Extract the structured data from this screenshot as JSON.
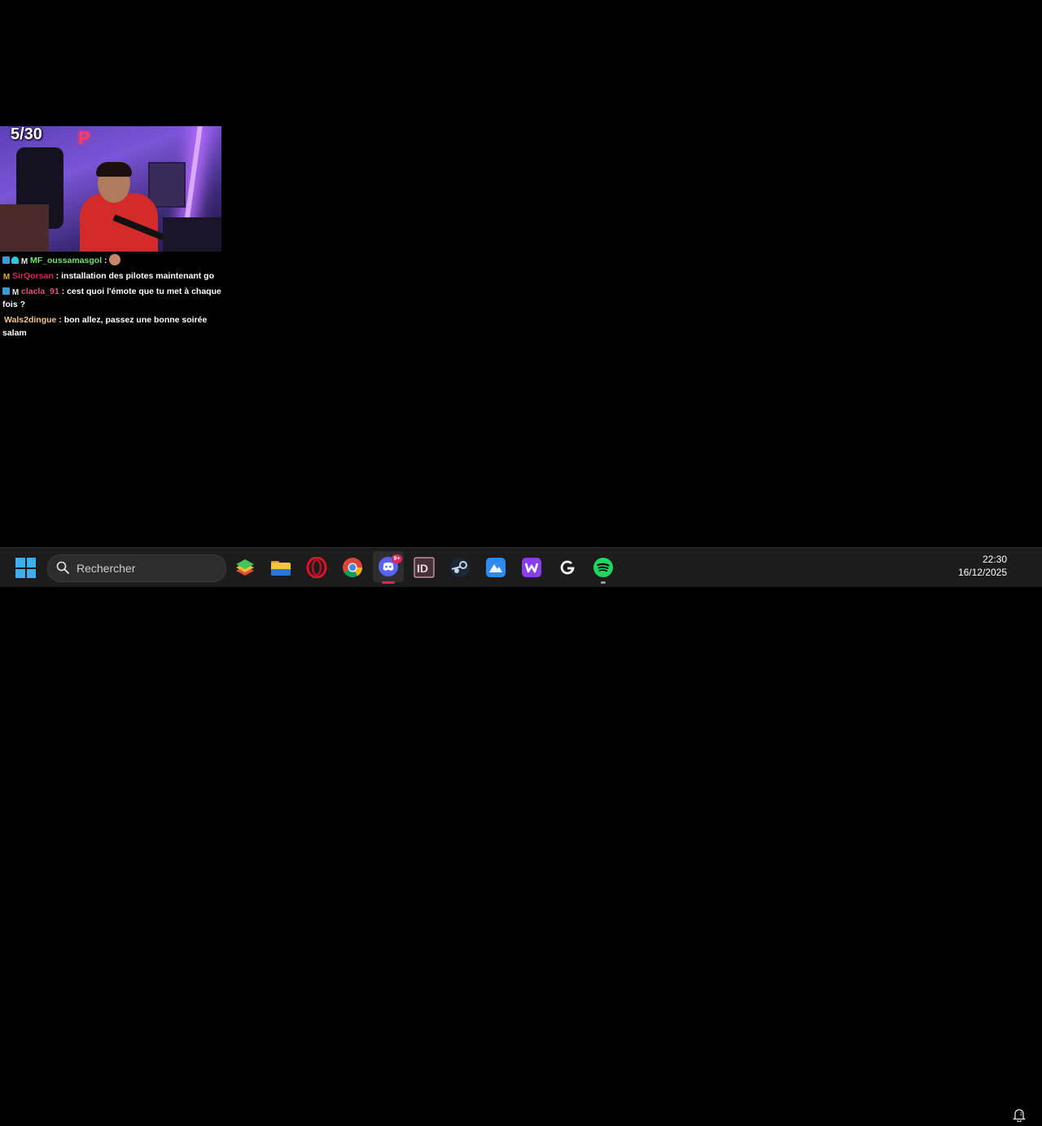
{
  "stream": {
    "counter": "5/30"
  },
  "chat": [
    {
      "badges": [
        "blue",
        "cyan",
        "m"
      ],
      "user": "MF_oussamasgol",
      "user_color": "#6ee36e",
      "separator": " :",
      "message": "",
      "has_emote": true
    },
    {
      "badges": [
        "m-gold"
      ],
      "user": "SirQorsan",
      "user_color": "#e0245e",
      "separator": " : ",
      "message": "installation des pilotes maintenant go",
      "has_emote": false
    },
    {
      "badges": [
        "blue",
        "m"
      ],
      "user": "clacla_91",
      "user_color": "#e0557a",
      "separator": " : ",
      "message": "cest quoi l'émote que tu met à chaque fois ?",
      "has_emote": false
    },
    {
      "badges": [],
      "user": "Wals2dingue",
      "user_color": "#f2c48a",
      "separator": " : ",
      "message": "bon allez, passez une bonne soirée salam",
      "has_emote": false
    }
  ],
  "taskbar": {
    "search_placeholder": "Rechercher",
    "apps": [
      {
        "name": "bluestacks-icon",
        "label": "BlueStacks"
      },
      {
        "name": "file-explorer-icon",
        "label": "File Explorer"
      },
      {
        "name": "opera-icon",
        "label": "Opera"
      },
      {
        "name": "chrome-icon",
        "label": "Google Chrome"
      },
      {
        "name": "discord-icon",
        "label": "Discord"
      },
      {
        "name": "indesign-icon",
        "label": "InDesign"
      },
      {
        "name": "steam-icon",
        "label": "Steam"
      },
      {
        "name": "altstore-icon",
        "label": "App"
      },
      {
        "name": "wuthering-icon",
        "label": "App W"
      },
      {
        "name": "logitech-icon",
        "label": "Logitech G HUB"
      },
      {
        "name": "spotify-icon",
        "label": "Spotify"
      }
    ],
    "discord_badge": "9+",
    "time": "22:30",
    "date": "16/12/2025"
  },
  "colors": {
    "accent": "#3ab0f0",
    "discord": "#5865f2",
    "spotify": "#1ed760",
    "notification": "#e0245e"
  }
}
